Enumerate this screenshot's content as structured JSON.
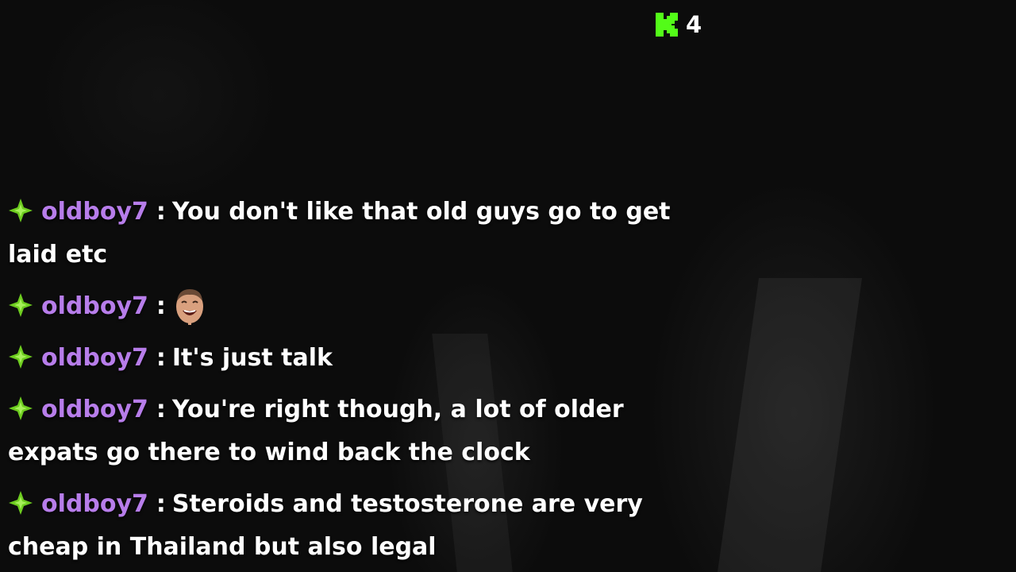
{
  "viewer": {
    "icon": "kick-icon",
    "count": "4",
    "color": "#53fc18"
  },
  "chat": {
    "username_color": "#b77dea",
    "badge_color": "#6dcc1f",
    "messages": [
      {
        "badge": "sparkle-badge-icon",
        "username": "oldboy7",
        "separator": ":",
        "text": "You don't like that old guys go to get laid etc"
      },
      {
        "badge": "sparkle-badge-icon",
        "username": "oldboy7",
        "separator": ":",
        "emote": "laughing-face-emote"
      },
      {
        "badge": "sparkle-badge-icon",
        "username": "oldboy7",
        "separator": ":",
        "text": "It's just talk"
      },
      {
        "badge": "sparkle-badge-icon",
        "username": "oldboy7",
        "separator": ":",
        "text": "You're right though, a lot of older expats go there to wind back the clock"
      },
      {
        "badge": "sparkle-badge-icon",
        "username": "oldboy7",
        "separator": ":",
        "text": "Steroids and testosterone are very cheap in Thailand but also legal"
      }
    ]
  }
}
